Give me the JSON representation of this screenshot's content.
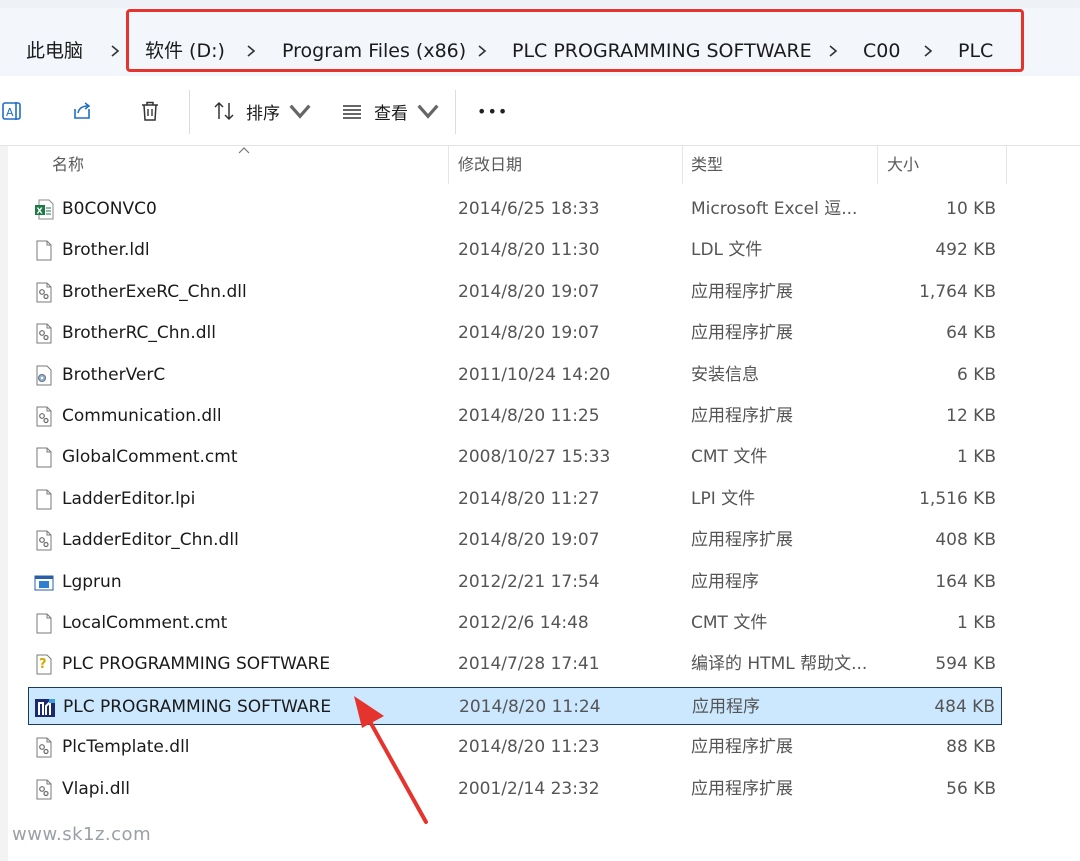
{
  "breadcrumb": {
    "items": [
      "此电脑",
      "软件 (D:)",
      "Program Files (x86)",
      "PLC PROGRAMMING SOFTWARE",
      "C00",
      "PLC"
    ]
  },
  "toolbar": {
    "sort_label": "排序",
    "view_label": "查看",
    "more_label": "•••"
  },
  "columns": {
    "name": "名称",
    "date": "修改日期",
    "type": "类型",
    "size": "大小"
  },
  "files": [
    {
      "name": "B0CONVC0",
      "date": "2014/6/25 18:33",
      "type": "Microsoft Excel 逗...",
      "size": "10 KB",
      "icon": "excel-icon"
    },
    {
      "name": "Brother.ldl",
      "date": "2014/8/20 11:30",
      "type": "LDL 文件",
      "size": "492 KB",
      "icon": "file-icon"
    },
    {
      "name": "BrotherExeRC_Chn.dll",
      "date": "2014/8/20 19:07",
      "type": "应用程序扩展",
      "size": "1,764 KB",
      "icon": "dll-icon"
    },
    {
      "name": "BrotherRC_Chn.dll",
      "date": "2014/8/20 19:07",
      "type": "应用程序扩展",
      "size": "64 KB",
      "icon": "dll-icon"
    },
    {
      "name": "BrotherVerC",
      "date": "2011/10/24 14:20",
      "type": "安装信息",
      "size": "6 KB",
      "icon": "setup-info-icon"
    },
    {
      "name": "Communication.dll",
      "date": "2014/8/20 11:25",
      "type": "应用程序扩展",
      "size": "12 KB",
      "icon": "dll-icon"
    },
    {
      "name": "GlobalComment.cmt",
      "date": "2008/10/27 15:33",
      "type": "CMT 文件",
      "size": "1 KB",
      "icon": "file-icon"
    },
    {
      "name": "LadderEditor.lpi",
      "date": "2014/8/20 11:27",
      "type": "LPI 文件",
      "size": "1,516 KB",
      "icon": "file-icon"
    },
    {
      "name": "LadderEditor_Chn.dll",
      "date": "2014/8/20 19:07",
      "type": "应用程序扩展",
      "size": "408 KB",
      "icon": "dll-icon"
    },
    {
      "name": "Lgprun",
      "date": "2012/2/21 17:54",
      "type": "应用程序",
      "size": "164 KB",
      "icon": "app-window-icon"
    },
    {
      "name": "LocalComment.cmt",
      "date": "2012/2/6 14:48",
      "type": "CMT 文件",
      "size": "1 KB",
      "icon": "file-icon"
    },
    {
      "name": "PLC PROGRAMMING SOFTWARE",
      "date": "2014/7/28 17:41",
      "type": "编译的 HTML 帮助文...",
      "size": "594 KB",
      "icon": "help-icon"
    },
    {
      "name": "PLC PROGRAMMING SOFTWARE",
      "date": "2014/8/20 11:24",
      "type": "应用程序",
      "size": "484 KB",
      "icon": "plc-app-icon",
      "selected": true
    },
    {
      "name": "PlcTemplate.dll",
      "date": "2014/8/20 11:23",
      "type": "应用程序扩展",
      "size": "88 KB",
      "icon": "dll-icon"
    },
    {
      "name": "Vlapi.dll",
      "date": "2001/2/14 23:32",
      "type": "应用程序扩展",
      "size": "56 KB",
      "icon": "dll-icon"
    }
  ],
  "watermark": "www.sk1z.com",
  "colors": {
    "highlight_box": "#e5342e",
    "selected_row": "#cce8ff",
    "annotation_arrow": "#e5342e"
  }
}
